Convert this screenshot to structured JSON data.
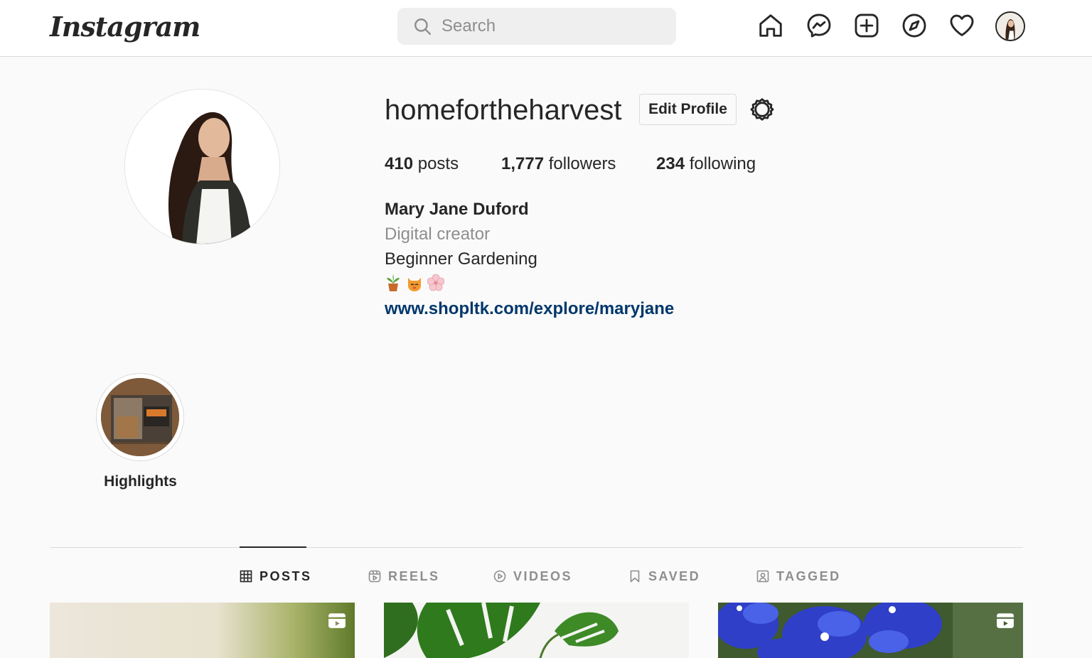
{
  "brand": {
    "logo_text": "Instagram"
  },
  "search": {
    "placeholder": "Search",
    "value": ""
  },
  "nav_icons": [
    "home-icon",
    "messenger-icon",
    "new-post-icon",
    "explore-icon",
    "activity-heart-icon",
    "profile-avatar"
  ],
  "profile": {
    "username": "homefortheharvest",
    "edit_label": "Edit Profile",
    "stats": {
      "posts_count": "410",
      "posts_label": "posts",
      "followers_count": "1,777",
      "followers_label": "followers",
      "following_count": "234",
      "following_label": "following"
    },
    "bio": {
      "name": "Mary Jane Duford",
      "category": "Digital creator",
      "text": "Beginner Gardening",
      "emojis": [
        "potted-plant",
        "orange-cat",
        "cherry-blossom"
      ],
      "link": "www.shopltk.com/explore/maryjane"
    }
  },
  "highlights": [
    {
      "label": "Highlights"
    }
  ],
  "tabs": [
    {
      "label": "POSTS",
      "icon": "grid-icon",
      "active": true
    },
    {
      "label": "REELS",
      "icon": "reels-icon",
      "active": false
    },
    {
      "label": "VIDEOS",
      "icon": "video-play-icon",
      "active": false
    },
    {
      "label": "SAVED",
      "icon": "bookmark-icon",
      "active": false
    },
    {
      "label": "TAGGED",
      "icon": "tagged-icon",
      "active": false
    }
  ],
  "posts": [
    {
      "type": "reel",
      "subject": "soft green gradient"
    },
    {
      "type": "reel",
      "subject": "monstera leaves"
    },
    {
      "type": "reel",
      "subject": "blue delphinium flowers"
    }
  ],
  "colors": {
    "link": "#00376b",
    "muted": "#8e8e8e",
    "text": "#262626",
    "border": "#dbdbdb"
  }
}
